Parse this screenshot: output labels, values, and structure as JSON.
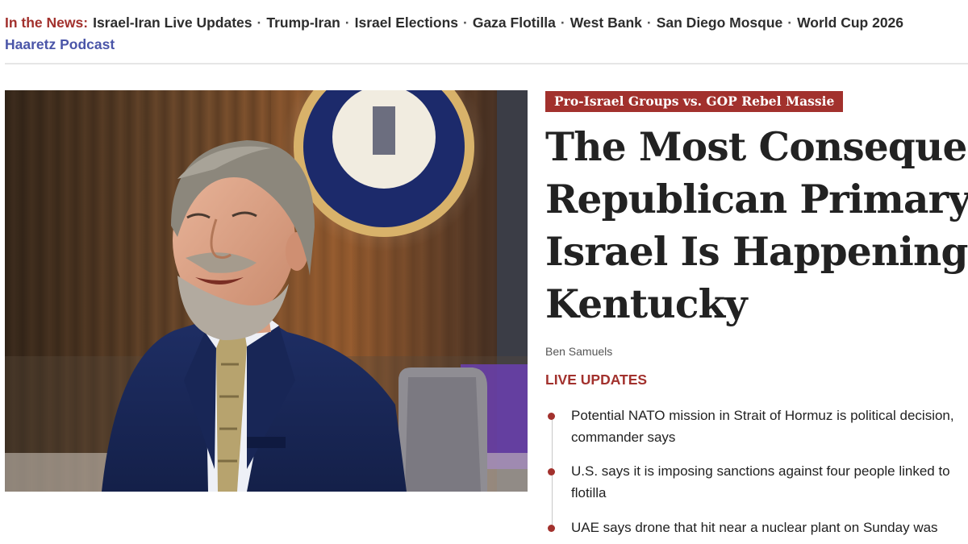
{
  "topics": {
    "label": "In the News:",
    "items": [
      "Israel-Iran Live Updates",
      "Trump-Iran",
      "Israel Elections",
      "Gaza Flotilla",
      "West Bank",
      "San Diego Mosque",
      "World Cup 2026"
    ],
    "separator": "·",
    "podcast": "Haaretz Podcast"
  },
  "article": {
    "kicker": "Pro-Israel Groups vs. GOP Rebel Massie",
    "headline_lines": [
      "The Most Consequential",
      "Republican Primary for",
      "Israel Is Happening in",
      "Kentucky"
    ],
    "byline": "Ben Samuels"
  },
  "live": {
    "label": "LIVE UPDATES",
    "items": [
      {
        "line1": "Potential NATO mission in Strait of Hormuz is political decision,",
        "line2": "commander says"
      },
      {
        "line1": "U.S. says it is imposing sanctions against four people linked to",
        "line2": "flotilla"
      },
      {
        "line1": "UAE says drone that hit near a nuclear plant on Sunday was"
      }
    ]
  },
  "colors": {
    "brand_red": "#a2312d",
    "podcast_blue": "#4a55a8",
    "text": "#222222"
  }
}
